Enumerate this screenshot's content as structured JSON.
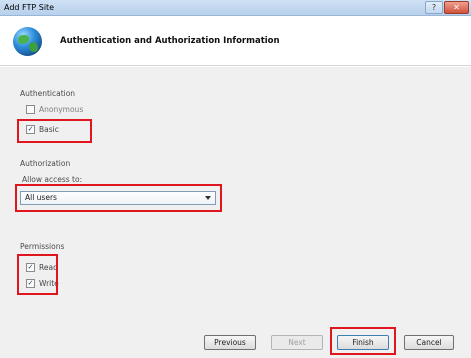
{
  "window": {
    "title": "Add FTP Site",
    "help_glyph": "?",
    "close_glyph": "✕"
  },
  "header": {
    "title": "Authentication and Authorization Information"
  },
  "authentication": {
    "section_label": "Authentication",
    "anonymous": {
      "label": "Anonymous",
      "checked": false
    },
    "basic": {
      "label": "Basic",
      "checked": true
    }
  },
  "authorization": {
    "section_label": "Authorization",
    "allow_access_label": "Allow access to:",
    "selected_option": "All users"
  },
  "permissions": {
    "section_label": "Permissions",
    "read": {
      "label": "Read",
      "checked": true
    },
    "write": {
      "label": "Write",
      "checked": true
    }
  },
  "buttons": {
    "previous": "Previous",
    "next": "Next",
    "finish": "Finish",
    "cancel": "Cancel"
  },
  "colors": {
    "highlight": "#e0161e",
    "titlebar": "#c3d8f0"
  }
}
